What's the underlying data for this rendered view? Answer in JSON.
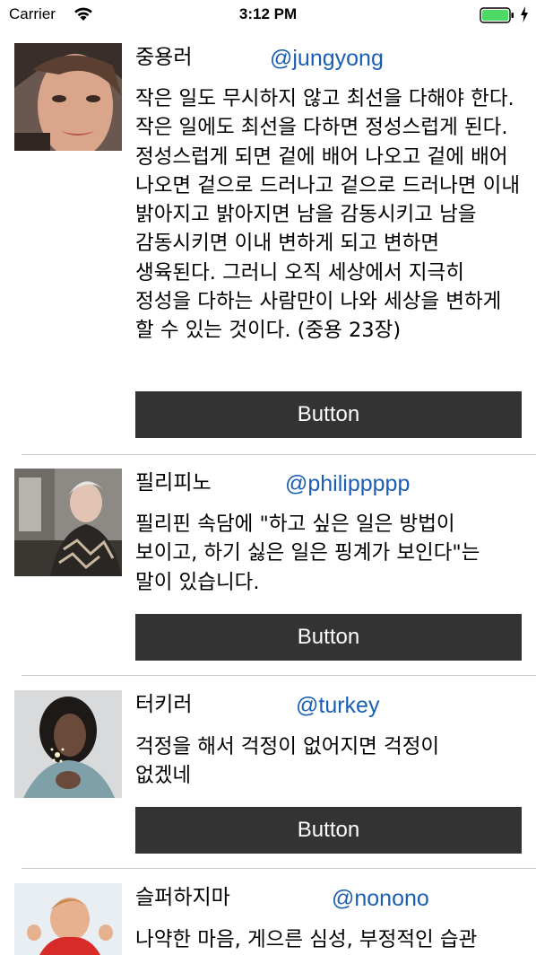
{
  "status_bar": {
    "carrier": "Carrier",
    "time": "3:12 PM"
  },
  "colors": {
    "button_bg": "#333333",
    "handle": "#1a5fb4",
    "battery_fill": "#4cd964"
  },
  "posts": [
    {
      "name": "중용러",
      "handle": "@jungyong",
      "body": "작은 일도 무시하지 않고 최선을 다해야 한다. 작은 일에도 최선을 다하면 정성스럽게 된다. 정성스럽게 되면 겉에 배어 나오고 겉에 배어 나오면 겉으로 드러나고 겉으로 드러나면 이내 밝아지고 밝아지면 남을 감동시키고 남을 감동시키면 이내 변하게 되고 변하면 생육된다. 그러니 오직 세상에서 지극히 정성을 다하는 사람만이 나와 세상을 변하게 할 수 있는 것이다. (중용 23장)",
      "button": "Button"
    },
    {
      "name": "필리피노",
      "handle": "@philippppp",
      "body": "필리핀 속담에 \"하고 싶은 일은 방법이 보이고, 하기 싫은 일은 핑계가 보인다\"는 말이 있습니다.",
      "button": "Button"
    },
    {
      "name": "터키러",
      "handle": "@turkey",
      "body": "걱정을 해서 걱정이 없어지면 걱정이 없겠네",
      "button": "Button"
    },
    {
      "name": "슬퍼하지마",
      "handle": "@nonono",
      "body": "나약한 마음, 게으른 심성, 부정적인 습관"
    }
  ]
}
